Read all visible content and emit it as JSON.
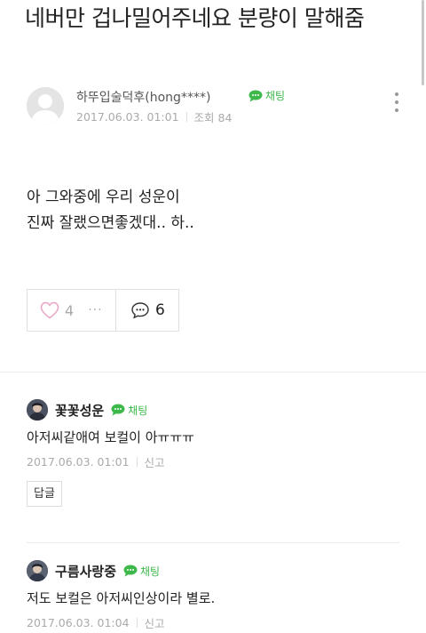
{
  "post": {
    "title": "네버만 겁나밀어주네요 분량이 말해줌",
    "author": "하뚜입술덕후(hong****)",
    "chat_label": "채팅",
    "date": "2017.06.03. 01:01",
    "views": "조회 84",
    "body_lines": [
      "아 그와중에 우리 성운이",
      "진짜 잘랬으면좋겠대.. 하.."
    ],
    "likes": "4",
    "more": "···",
    "comments": "6"
  },
  "comments": [
    {
      "name": "꽃꽃성운",
      "chat_label": "채팅",
      "text": "아저씨같애여 보컬이 아ㅠㅠㅠ",
      "date": "2017.06.03. 01:01",
      "report": "신고",
      "reply": "답글"
    },
    {
      "name": "구름사랑중",
      "chat_label": "채팅",
      "text": "저도 보컬은 아저씨인상이라 별로.",
      "date": "2017.06.03. 01:04",
      "report": "신고"
    }
  ],
  "colors": {
    "chat_green": "#3db84b",
    "meta_gray": "#aaaaaa"
  },
  "icons": [
    "chat-bubble-icon",
    "heart-icon",
    "comment-icon",
    "kebab-menu-icon",
    "default-avatar-icon"
  ]
}
